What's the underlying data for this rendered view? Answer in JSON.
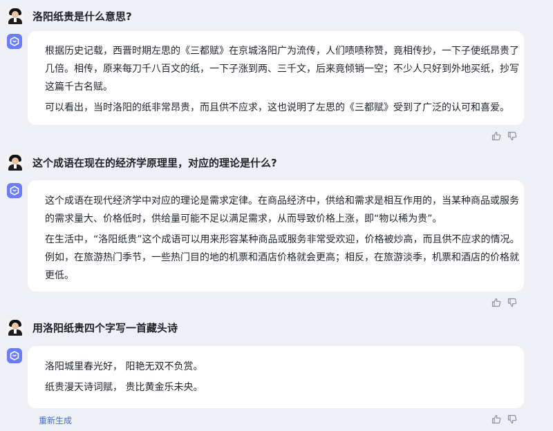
{
  "conversation": [
    {
      "question": "洛阳纸贵是什么意思?",
      "answer": [
        "根据历史记载，西晋时期左思的《三都赋》在京城洛阳广为流传，人们啧啧称赞，竟相传抄，一下子使纸昂贵了",
        "几倍。相传，原来每刀千八百文的纸，一下子涨到两、三千文，后来竟倾销一空；不少人只好到外地买纸，抄写",
        "这篇千古名赋。",
        "可以看出，当时洛阳的纸非常昂贵，而且供不应求，这也说明了左思的《三都赋》受到了广泛的认可和喜爱。"
      ]
    },
    {
      "question": "这个成语在现在的经济学原理里，对应的理论是什么?",
      "answer": [
        "这个成语在现代经济学中对应的理论是需求定律。在商品经济中，供给和需求是相互作用的，当某种商品或服务",
        "的需求量大、价格低时，供给量可能不足以满足需求，从而导致价格上涨，即“物以稀为贵”。",
        "在生活中，“洛阳纸贵”这个成语可以用来形容某种商品或服务非常受欢迎，价格被炒高，而且供不应求的情况。",
        "例如，在旅游热门季节，一些热门目的地的机票和酒店价格就会更高；相反，在旅游淡季，机票和酒店的价格就",
        "更低。"
      ]
    },
    {
      "question": "用洛阳纸贵四个字写一首藏头诗",
      "answer": [
        "洛阳城里春光好， 阳艳无双不负赏。",
        "纸贵漫天诗词赋， 贵比黄金乐未央。"
      ]
    }
  ],
  "actions": {
    "regenerate": "重新生成"
  },
  "colors": {
    "background": "#eef0f6",
    "card": "#ffffff",
    "bot_icon": "#6b7cf7",
    "link": "#3d6bd8"
  },
  "icons": [
    "user-avatar",
    "bot-icon",
    "thumb-up-icon",
    "thumb-down-icon"
  ]
}
